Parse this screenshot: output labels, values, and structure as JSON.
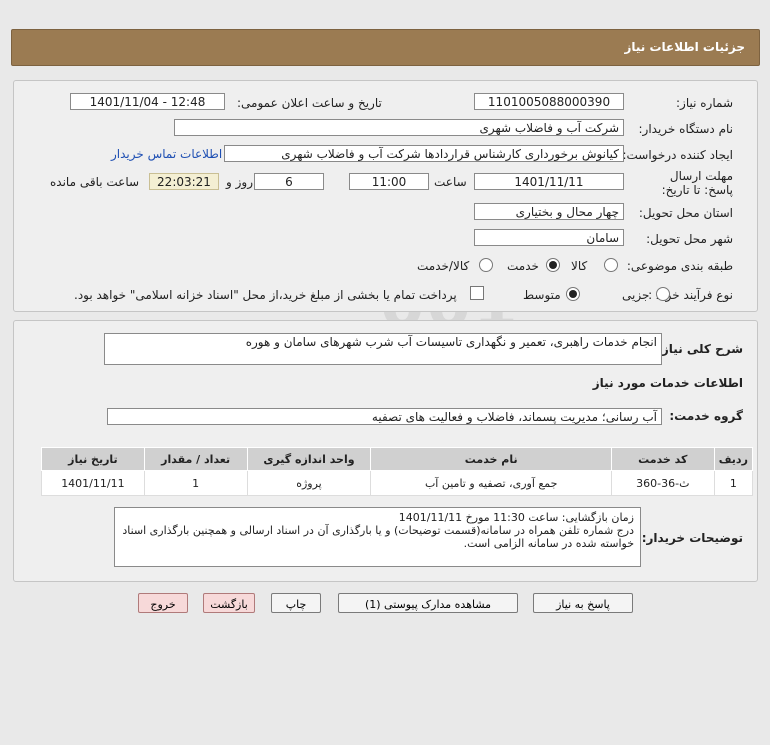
{
  "header": {
    "title": "جزئیات اطلاعات نیاز"
  },
  "form": {
    "need_number_label": "شماره نیاز:",
    "need_number": "1101005088000390",
    "announce_label": "تاریخ و ساعت اعلان عمومی:",
    "announce_value": "1401/11/04 - 12:48",
    "buyer_label": "نام دستگاه خریدار:",
    "buyer_value": "شرکت آب و فاضلاب شهری",
    "creator_label": "ایجاد کننده درخواست:",
    "creator_value": "کیانوش برخورداری کارشناس قراردادها شرکت آب و فاضلاب شهری",
    "contact_link": "اطلاعات تماس خریدار",
    "deadline_label": "مهلت ارسال پاسخ: تا تاریخ:",
    "deadline_date": "1401/11/11",
    "time_label": "ساعت",
    "deadline_time": "11:00",
    "days_value": "6",
    "days_label": "روز و",
    "remaining_time": "22:03:21",
    "remaining_label": "ساعت باقی مانده",
    "province_label": "استان محل تحویل:",
    "province_value": "چهار محال و بختیاری",
    "city_label": "شهر محل تحویل:",
    "city_value": "سامان",
    "category_label": "طبقه بندی موضوعی:",
    "category_options": [
      "کالا",
      "خدمت",
      "کالا/خدمت"
    ],
    "category_selected": "خدمت",
    "process_label": "نوع فرآیند خرید :",
    "process_options": [
      "جزیی",
      "متوسط"
    ],
    "process_selected": "متوسط",
    "payment_note": "پرداخت تمام یا بخشی از مبلغ خرید،از محل \"اسناد خزانه اسلامی\" خواهد بود."
  },
  "details": {
    "summary_label": "شرح کلی نیاز:",
    "summary_value": "انجام خدمات راهبری، تعمیر و نگهداری تاسیسات آب شرب شهرهای سامان و هوره",
    "services_heading": "اطلاعات خدمات مورد نیاز",
    "service_group_label": "گروه خدمت:",
    "service_group_value": "آب رسانی؛ مدیریت پسماند، فاضلاب و فعالیت های تصفیه",
    "table": {
      "headers": [
        "ردیف",
        "کد خدمت",
        "نام خدمت",
        "واحد اندازه گیری",
        "تعداد / مقدار",
        "تاریخ نیاز"
      ],
      "rows": [
        [
          "1",
          "ث-36-360",
          "جمع آوری، تصفیه و تامین آب",
          "پروژه",
          "1",
          "1401/11/11"
        ]
      ]
    },
    "buyer_notes_label": "توضیحات خریدار:",
    "buyer_notes_line1": "زمان بازگشایی: ساعت 11:30 مورخ 1401/11/11",
    "buyer_notes_line2": "درج شماره تلفن همراه در سامانه(قسمت توضیحات) و یا بارگذاری آن در اسناد ارسالی و همچنین بارگذاری اسناد خواسته شده در سامانه الزامی است."
  },
  "buttons": {
    "reply": "پاسخ به نیاز",
    "attachments": "مشاهده مدارک پیوستی (1)",
    "print": "چاپ",
    "back": "بازگشت",
    "exit": "خروج"
  }
}
